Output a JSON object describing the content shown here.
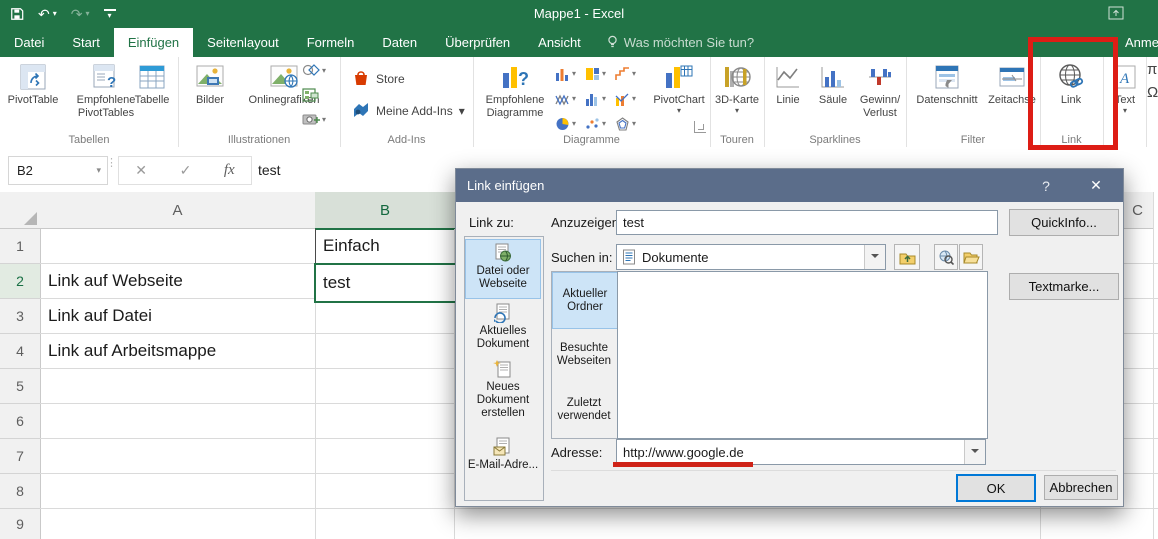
{
  "titlebar": {
    "title": "Mappe1 - Excel",
    "signin": "Anmeld"
  },
  "tabs": {
    "items": [
      {
        "label": "Datei"
      },
      {
        "label": "Start"
      },
      {
        "label": "Einfügen",
        "active": true
      },
      {
        "label": "Seitenlayout"
      },
      {
        "label": "Formeln"
      },
      {
        "label": "Daten"
      },
      {
        "label": "Überprüfen"
      },
      {
        "label": "Ansicht"
      }
    ],
    "tellme": "Was möchten Sie tun?"
  },
  "ribbon": {
    "tabellen": {
      "label": "Tabellen",
      "pivottable": "PivotTable",
      "empfohlene": "Empfohlene PivotTables",
      "tabelle": "Tabelle"
    },
    "illustrationen": {
      "label": "Illustrationen",
      "bilder": "Bilder",
      "onlinegrafiken": "Onlinegrafiken"
    },
    "addins": {
      "label": "Add-Ins",
      "store": "Store",
      "meine": "Meine Add-Ins"
    },
    "diagramme": {
      "label": "Diagramme",
      "empfohlene": "Empfohlene Diagramme",
      "pivotchart": "PivotChart"
    },
    "touren": {
      "label": "Touren",
      "karte": "3D-Karte"
    },
    "sparklines": {
      "label": "Sparklines",
      "linie": "Linie",
      "saeule": "Säule",
      "gewinn_verlust": "Gewinn/ Verlust"
    },
    "filter": {
      "label": "Filter",
      "datenschnitt": "Datenschnitt",
      "zeitachse": "Zeitachse"
    },
    "link": {
      "label": "Link",
      "button": "Link"
    },
    "text": {
      "button": "Text",
      "pi": "π",
      "omega": "Ω"
    }
  },
  "formula_bar": {
    "name_box": "B2",
    "value": "test"
  },
  "sheet": {
    "columns": {
      "a": "A",
      "b": "B",
      "c": "C"
    },
    "rows": [
      "1",
      "2",
      "3",
      "4",
      "5",
      "6",
      "7",
      "8",
      "9"
    ],
    "cells": {
      "b1": "Einfach",
      "a2": "Link auf Webseite",
      "b2": "test",
      "a3": "Link auf Datei",
      "a4": "Link auf Arbeitsmappe"
    }
  },
  "dialog": {
    "title": "Link einfügen",
    "link_zu": "Link zu:",
    "sidebar": [
      {
        "label": "Datei oder Webseite",
        "selected": true
      },
      {
        "label": "Aktuelles Dokument"
      },
      {
        "label": "Neues Dokument erstellen"
      },
      {
        "label": "E-Mail-Adre..."
      }
    ],
    "display_text_label": "Anzuzeigender Text:",
    "display_text_value": "test",
    "quickinfo": "QuickInfo...",
    "suchen_label": "Suchen in:",
    "suchen_value": "Dokumente",
    "tabs": [
      {
        "label": "Aktueller Ordner",
        "selected": true
      },
      {
        "label": "Besuchte Webseiten"
      },
      {
        "label": "Zuletzt verwendet"
      }
    ],
    "textmarke": "Textmarke...",
    "adresse_label": "Adresse:",
    "adresse_value": "http://www.google.de",
    "ok": "OK",
    "cancel": "Abbrechen"
  },
  "icons": {
    "help": "?",
    "close": "✕",
    "undo": "↶",
    "redo": "↷",
    "cancel": "✕",
    "enter": "✓"
  },
  "colors": {
    "excel_green": "#217346",
    "dialog_titlebar": "#5b6d8a",
    "annotation_red": "#dd1d15",
    "selection_blue": "#cde4f7"
  }
}
